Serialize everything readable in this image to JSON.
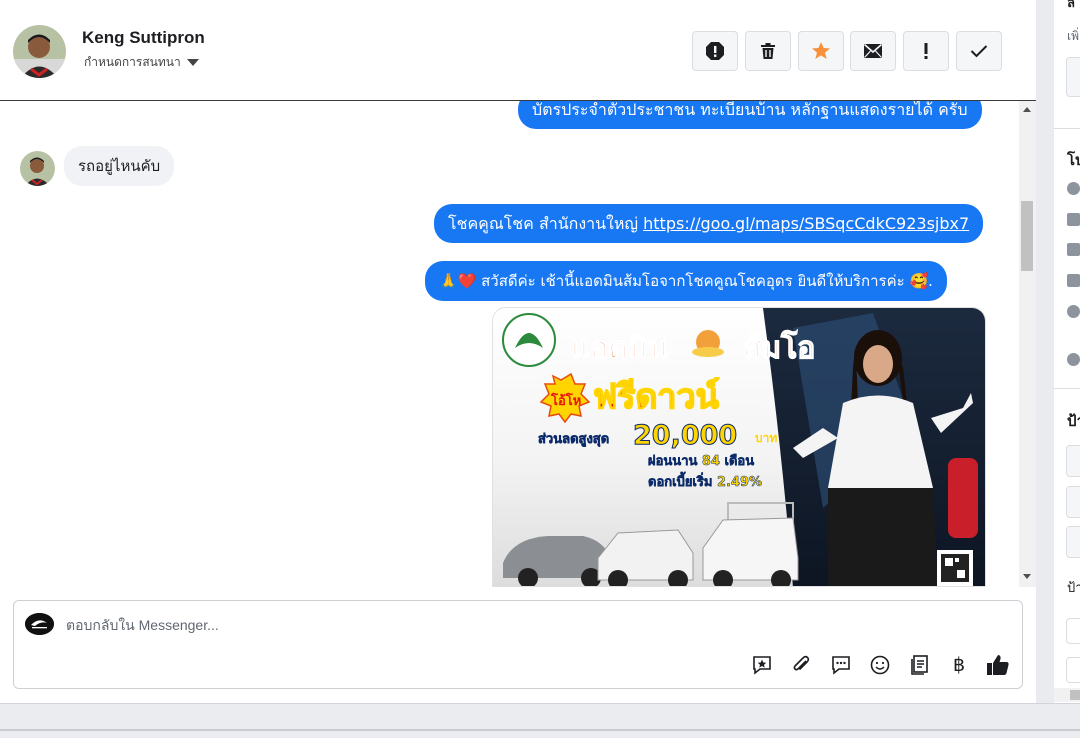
{
  "header": {
    "contact_name": "Keng Suttipron",
    "conversation_settings": "กำหนดการสนทนา"
  },
  "toolbar": {
    "buttons": [
      "report-icon",
      "trash-icon",
      "star-icon",
      "envelope-icon",
      "exclamation-icon",
      "check-icon"
    ]
  },
  "messages": {
    "out_1": "บัตรประจำตัวประชาชน ทะเบียนบ้าน หลักฐานแสดงรายได้ ครับ",
    "in_1": "รถอยู่ไหนคับ",
    "out_2_text": "โชคคูณโชค สำนักงานใหญ่ ",
    "out_2_link": "https://goo.gl/maps/SBSqcCdkC923sjbx7",
    "out_3": "🙏❤️ สวัสดีค่ะ เช้านี้แอดมินส้มโอจากโชคคูณโชคอุดร ยินดีให้บริการค่ะ  🥰."
  },
  "promo": {
    "headline_1": "แอดมิน",
    "headline_2": "ส้มโอ",
    "badge": "โอ้โห",
    "free_down": "ฟรีดาวน์",
    "discount_label": "ส่วนลดสูงสุด",
    "discount_value": "20,000",
    "currency": "บาท",
    "installment": "ผ่อนนาน 84 เดือน",
    "interest": "ดอกเบี้ยเริ่ม 2.49%"
  },
  "composer": {
    "placeholder": "ตอบกลับใน Messenger...",
    "currency_symbol": "฿"
  },
  "right_panel": {
    "line_1": "เพิ่",
    "section_1": "โป",
    "section_2": "ป้า",
    "line_2": "ป้า"
  },
  "colors": {
    "bubble_out": "#1877f2",
    "bubble_in": "#f0f2f5",
    "star": "#f7923b",
    "promo_orange": "#e84a0c",
    "promo_yellow": "#ffd400"
  }
}
